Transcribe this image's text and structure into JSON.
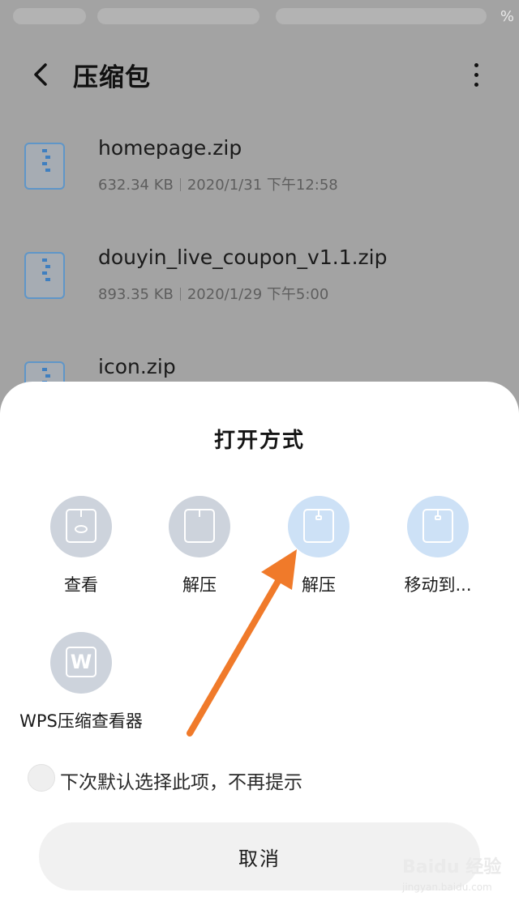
{
  "status_bar": {
    "battery_suffix": "%"
  },
  "header": {
    "title": "压缩包"
  },
  "files": [
    {
      "name": "homepage.zip",
      "size": "632.34 KB",
      "date": "2020/1/31 下午12:58"
    },
    {
      "name": "douyin_live_coupon_v1.1.zip",
      "size": "893.35 KB",
      "date": "2020/1/29 下午5:00"
    },
    {
      "name": "icon.zip",
      "size": "",
      "date": ""
    }
  ],
  "sheet": {
    "title": "打开方式",
    "options": [
      {
        "label": "查看"
      },
      {
        "label": "解压"
      },
      {
        "label": "解压"
      },
      {
        "label": "移动到..."
      },
      {
        "label": "WPS压缩查看器"
      }
    ],
    "remember_text": "下次默认选择此项，不再提示",
    "cancel_label": "取消"
  },
  "annotation": {
    "arrow_color": "#f07a2a"
  },
  "watermark": {
    "text": "Baidu 经验",
    "sub": "jingyan.baidu.com"
  }
}
